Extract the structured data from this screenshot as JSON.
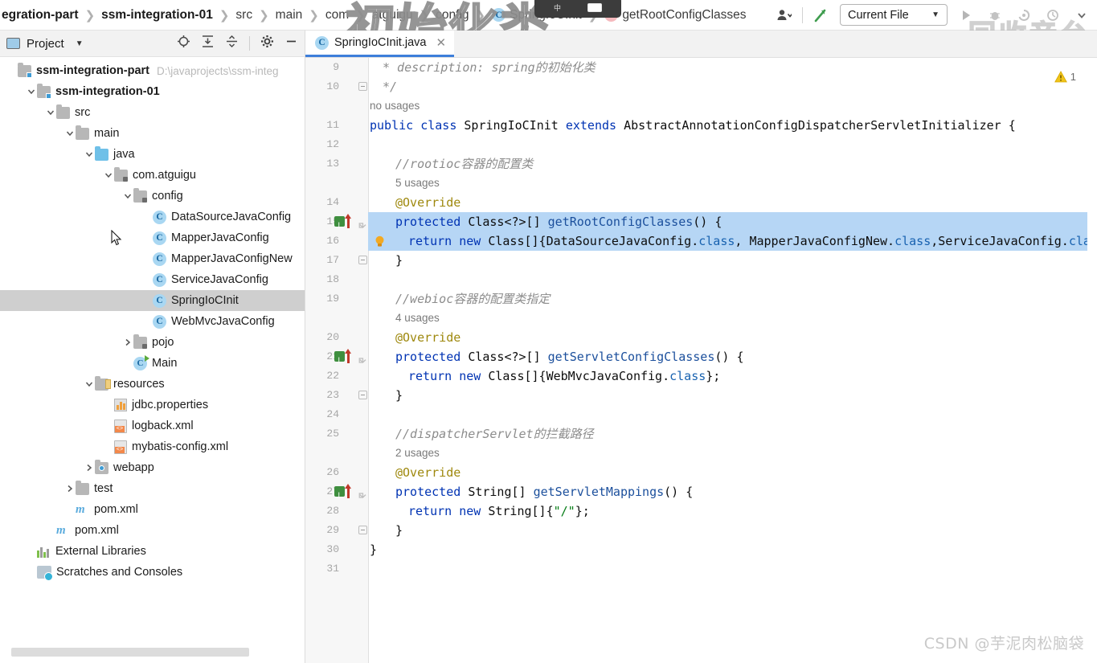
{
  "toolbar": {
    "breadcrumbs": [
      {
        "label": "egration-part",
        "icon": "none",
        "bold": true
      },
      {
        "label": "ssm-integration-01",
        "icon": "none",
        "bold": true
      },
      {
        "label": "src",
        "icon": "none",
        "bold": false
      },
      {
        "label": "main",
        "icon": "none",
        "bold": false
      },
      {
        "label": "com",
        "icon": "none",
        "bold": false
      },
      {
        "label": "atguigu",
        "icon": "none",
        "bold": false
      },
      {
        "label": "config",
        "icon": "none",
        "bold": false
      },
      {
        "label": "SpringIoCInit",
        "icon": "class-icon",
        "bold": false
      },
      {
        "label": "getRootConfigClasses",
        "icon": "method-icon",
        "bold": false
      }
    ],
    "overlay_text": "初始化类",
    "watermark_right": "回收音台",
    "run_config": "Current File",
    "run_config_caret": "▼",
    "icons": {
      "avatar": "user-icon",
      "avatar_caret": "▼",
      "search_everywhere": "hammer-build-icon",
      "run": "run-icon",
      "debug": "debug-icon",
      "coverage": "coverage-icon",
      "profiler": "profiler-icon",
      "more": "chevron-down-icon"
    }
  },
  "project_panel": {
    "title": "Project",
    "title_caret": "▼",
    "tools": [
      "locate-icon",
      "expand-all-icon",
      "collapse-all-icon",
      "settings-gear-icon",
      "minimize-icon"
    ],
    "tree": [
      {
        "depth": 0,
        "label": "ssm-integration-part",
        "icon": "module-folder",
        "twisty": "",
        "bold": true,
        "path": "D:\\javaprojects\\ssm-integ",
        "selected": false
      },
      {
        "depth": 1,
        "label": "ssm-integration-01",
        "icon": "module-folder",
        "twisty": "v",
        "bold": true,
        "path": "",
        "selected": false
      },
      {
        "depth": 2,
        "label": "src",
        "icon": "folder-gray",
        "twisty": "v",
        "bold": false,
        "path": "",
        "selected": false
      },
      {
        "depth": 3,
        "label": "main",
        "icon": "folder-gray",
        "twisty": "v",
        "bold": false,
        "path": "",
        "selected": false
      },
      {
        "depth": 4,
        "label": "java",
        "icon": "folder-source-blue",
        "twisty": "v",
        "bold": false,
        "path": "",
        "selected": false
      },
      {
        "depth": 5,
        "label": "com.atguigu",
        "icon": "package-folder",
        "twisty": "v",
        "bold": false,
        "path": "",
        "selected": false
      },
      {
        "depth": 6,
        "label": "config",
        "icon": "package-folder",
        "twisty": "v",
        "bold": false,
        "path": "",
        "selected": false
      },
      {
        "depth": 7,
        "label": "DataSourceJavaConfig",
        "icon": "class-icon",
        "twisty": "",
        "bold": false,
        "path": "",
        "selected": false
      },
      {
        "depth": 7,
        "label": "MapperJavaConfig",
        "icon": "class-icon",
        "twisty": "",
        "bold": false,
        "path": "",
        "selected": false
      },
      {
        "depth": 7,
        "label": "MapperJavaConfigNew",
        "icon": "class-icon",
        "twisty": "",
        "bold": false,
        "path": "",
        "selected": false
      },
      {
        "depth": 7,
        "label": "ServiceJavaConfig",
        "icon": "class-icon",
        "twisty": "",
        "bold": false,
        "path": "",
        "selected": false
      },
      {
        "depth": 7,
        "label": "SpringIoCInit",
        "icon": "class-icon",
        "twisty": "",
        "bold": false,
        "path": "",
        "selected": true
      },
      {
        "depth": 7,
        "label": "WebMvcJavaConfig",
        "icon": "class-icon",
        "twisty": "",
        "bold": false,
        "path": "",
        "selected": false
      },
      {
        "depth": 6,
        "label": "pojo",
        "icon": "package-folder",
        "twisty": ">",
        "bold": false,
        "path": "",
        "selected": false
      },
      {
        "depth": 6,
        "label": "Main",
        "icon": "runnable-class-icon",
        "twisty": "",
        "bold": false,
        "path": "",
        "selected": false
      },
      {
        "depth": 4,
        "label": "resources",
        "icon": "folder-resources",
        "twisty": "v",
        "bold": false,
        "path": "",
        "selected": false
      },
      {
        "depth": 5,
        "label": "jdbc.properties",
        "icon": "properties-icon",
        "twisty": "",
        "bold": false,
        "path": "",
        "selected": false
      },
      {
        "depth": 5,
        "label": "logback.xml",
        "icon": "xml-icon",
        "twisty": "",
        "bold": false,
        "path": "",
        "selected": false
      },
      {
        "depth": 5,
        "label": "mybatis-config.xml",
        "icon": "xml-icon",
        "twisty": "",
        "bold": false,
        "path": "",
        "selected": false
      },
      {
        "depth": 4,
        "label": "webapp",
        "icon": "folder-webapp",
        "twisty": ">",
        "bold": false,
        "path": "",
        "selected": false
      },
      {
        "depth": 3,
        "label": "test",
        "icon": "folder-gray",
        "twisty": ">",
        "bold": false,
        "path": "",
        "selected": false
      },
      {
        "depth": 3,
        "label": "pom.xml",
        "icon": "maven-icon",
        "twisty": "",
        "bold": false,
        "path": "",
        "selected": false
      },
      {
        "depth": 2,
        "label": "pom.xml",
        "icon": "maven-icon",
        "twisty": "",
        "bold": false,
        "path": "",
        "selected": false
      },
      {
        "depth": 1,
        "label": "External Libraries",
        "icon": "libraries-icon",
        "twisty": "",
        "bold": false,
        "path": "",
        "selected": false
      },
      {
        "depth": 1,
        "label": "Scratches and Consoles",
        "icon": "scratches-icon",
        "twisty": "",
        "bold": false,
        "path": "",
        "selected": false
      }
    ]
  },
  "editor": {
    "tab": {
      "label": "SpringIoCInit.java",
      "icon": "class-icon",
      "close": "✕"
    },
    "warning_count": "1",
    "warning_icon": "warning-triangle-icon",
    "lines": [
      {
        "num": "9",
        "kind": "code",
        "indent": 1,
        "html": "<span class='doc'>* description: spring的初始化类</span>"
      },
      {
        "num": "10",
        "kind": "code",
        "indent": 1,
        "html": "<span class='doc'>*/</span>",
        "fold": "minus"
      },
      {
        "num": "",
        "kind": "hint",
        "text": "no usages"
      },
      {
        "num": "11",
        "kind": "code",
        "indent": 0,
        "html": "<span class='kw'>public class </span>SpringIoCInit <span class='kw'>extends </span>AbstractAnnotationConfigDispatcherServletInitializer {"
      },
      {
        "num": "12",
        "kind": "code",
        "indent": 0,
        "html": ""
      },
      {
        "num": "13",
        "kind": "code",
        "indent": 2,
        "html": "<span class='cmt'>//rootioc容器的配置类</span>"
      },
      {
        "num": "",
        "kind": "hint",
        "text": "5 usages",
        "indent": 2
      },
      {
        "num": "14",
        "kind": "code",
        "indent": 2,
        "html": "<span class='ann'>@Override</span>"
      },
      {
        "num": "15",
        "kind": "code",
        "indent": 2,
        "html": "<span class='kw'>protected </span>Class&lt;?&gt;[] <span class='mth'>getRootConfigClasses</span>() {",
        "selected": true,
        "override": true,
        "fold": "arrow"
      },
      {
        "num": "16",
        "kind": "code",
        "indent": 3,
        "html": "<span class='kw'>return new </span>Class[]{DataSourceJavaConfig.<span class='fld'>class</span>, MapperJavaConfigNew.<span class='fld'>class</span>,ServiceJavaConfig.<span class='fld'>class</span>};",
        "selected": true,
        "bulb": true
      },
      {
        "num": "17",
        "kind": "code",
        "indent": 2,
        "html": "}",
        "fold": "minus"
      },
      {
        "num": "18",
        "kind": "code",
        "indent": 0,
        "html": ""
      },
      {
        "num": "19",
        "kind": "code",
        "indent": 2,
        "html": "<span class='cmt'>//webioc容器的配置类指定</span>"
      },
      {
        "num": "",
        "kind": "hint",
        "text": "4 usages",
        "indent": 2
      },
      {
        "num": "20",
        "kind": "code",
        "indent": 2,
        "html": "<span class='ann'>@Override</span>"
      },
      {
        "num": "21",
        "kind": "code",
        "indent": 2,
        "html": "<span class='kw'>protected </span>Class&lt;?&gt;[] <span class='mth'>getServletConfigClasses</span>() {",
        "override": true,
        "fold": "arrow"
      },
      {
        "num": "22",
        "kind": "code",
        "indent": 3,
        "html": "<span class='kw'>return new </span>Class[]{WebMvcJavaConfig.<span class='fld'>class</span>};"
      },
      {
        "num": "23",
        "kind": "code",
        "indent": 2,
        "html": "}",
        "fold": "minus"
      },
      {
        "num": "24",
        "kind": "code",
        "indent": 0,
        "html": ""
      },
      {
        "num": "25",
        "kind": "code",
        "indent": 2,
        "html": "<span class='cmt'>//dispatcherServlet的拦截路径</span>"
      },
      {
        "num": "",
        "kind": "hint",
        "text": "2 usages",
        "indent": 2
      },
      {
        "num": "26",
        "kind": "code",
        "indent": 2,
        "html": "<span class='ann'>@Override</span>"
      },
      {
        "num": "27",
        "kind": "code",
        "indent": 2,
        "html": "<span class='kw'>protected </span>String[] <span class='mth'>getServletMappings</span>() {",
        "override": true,
        "fold": "arrow"
      },
      {
        "num": "28",
        "kind": "code",
        "indent": 3,
        "html": "<span class='kw'>return new </span>String[]{<span class='str'>\"/\"</span>};"
      },
      {
        "num": "29",
        "kind": "code",
        "indent": 2,
        "html": "}",
        "fold": "minus"
      },
      {
        "num": "30",
        "kind": "code",
        "indent": 0,
        "html": "}"
      },
      {
        "num": "31",
        "kind": "code",
        "indent": 0,
        "html": ""
      }
    ]
  },
  "watermark": "CSDN @芋泥肉松脑袋",
  "colors": {
    "selection": "#b6d6f5",
    "keyword": "#0033b3",
    "comment": "#8c8c8c",
    "annotation": "#9e880d",
    "method": "#1b4f9c",
    "string": "#067d17",
    "tab_underline": "#3d7eda",
    "tree_selected": "#cfcfcf",
    "warning": "#e8b931"
  }
}
